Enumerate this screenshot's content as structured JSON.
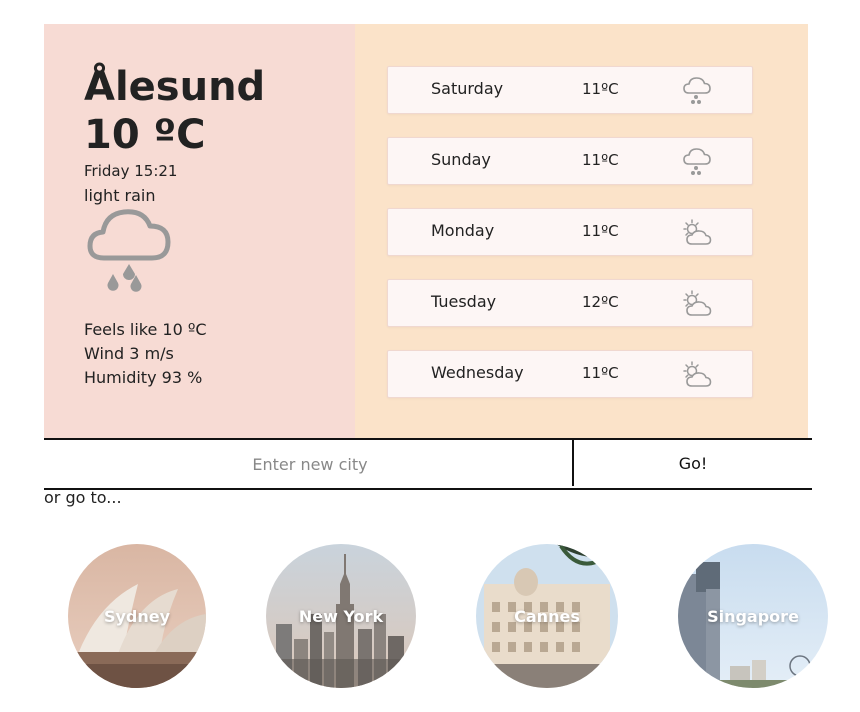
{
  "current": {
    "city": "Ålesund",
    "temperature": "10 ºC",
    "datetime": "Friday 15:21",
    "description": "light rain",
    "icon": "rain-cloud-icon",
    "feels_like": "Feels like 10 ºC",
    "wind": "Wind 3 m/s",
    "humidity": "Humidity 93 %"
  },
  "forecast": [
    {
      "day": "Saturday",
      "temp": "11ºC",
      "icon": "rain-cloud-icon"
    },
    {
      "day": "Sunday",
      "temp": "11ºC",
      "icon": "rain-cloud-icon"
    },
    {
      "day": "Monday",
      "temp": "11ºC",
      "icon": "partly-cloudy-icon"
    },
    {
      "day": "Tuesday",
      "temp": "12ºC",
      "icon": "partly-cloudy-icon"
    },
    {
      "day": "Wednesday",
      "temp": "11ºC",
      "icon": "partly-cloudy-icon"
    }
  ],
  "search": {
    "placeholder": "Enter new city",
    "button_label": "Go!"
  },
  "goto_label": "or go to...",
  "destinations": [
    {
      "name": "Sydney"
    },
    {
      "name": "New York"
    },
    {
      "name": "Cannes"
    },
    {
      "name": "Singapore"
    }
  ],
  "colors": {
    "current_panel_bg": "#f7dbd4",
    "forecast_panel_bg": "#fbe3c9",
    "icon_gray": "#999999"
  }
}
